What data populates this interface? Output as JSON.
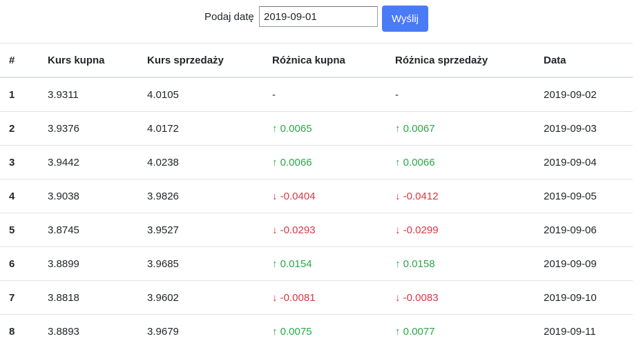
{
  "form": {
    "label": "Podaj datę",
    "date_value": "2019-09-01",
    "submit_label": "Wyślij"
  },
  "colors": {
    "accent": "#4a7bf7",
    "up": "#28a745",
    "down": "#dc3545"
  },
  "table": {
    "headers": [
      "#",
      "Kurs kupna",
      "Kurs sprzedaży",
      "Różnica kupna",
      "Różnica sprzedaży",
      "Data"
    ],
    "rows": [
      {
        "idx": "1",
        "buy": "3.9311",
        "sell": "4.0105",
        "buy_diff": "-",
        "buy_dir": "none",
        "sell_diff": "-",
        "sell_dir": "none",
        "date": "2019-09-02"
      },
      {
        "idx": "2",
        "buy": "3.9376",
        "sell": "4.0172",
        "buy_diff": "↑ 0.0065",
        "buy_dir": "up",
        "sell_diff": "↑ 0.0067",
        "sell_dir": "up",
        "date": "2019-09-03"
      },
      {
        "idx": "3",
        "buy": "3.9442",
        "sell": "4.0238",
        "buy_diff": "↑ 0.0066",
        "buy_dir": "up",
        "sell_diff": "↑ 0.0066",
        "sell_dir": "up",
        "date": "2019-09-04"
      },
      {
        "idx": "4",
        "buy": "3.9038",
        "sell": "3.9826",
        "buy_diff": "↓ -0.0404",
        "buy_dir": "down",
        "sell_diff": "↓ -0.0412",
        "sell_dir": "down",
        "date": "2019-09-05"
      },
      {
        "idx": "5",
        "buy": "3.8745",
        "sell": "3.9527",
        "buy_diff": "↓ -0.0293",
        "buy_dir": "down",
        "sell_diff": "↓ -0.0299",
        "sell_dir": "down",
        "date": "2019-09-06"
      },
      {
        "idx": "6",
        "buy": "3.8899",
        "sell": "3.9685",
        "buy_diff": "↑ 0.0154",
        "buy_dir": "up",
        "sell_diff": "↑ 0.0158",
        "sell_dir": "up",
        "date": "2019-09-09"
      },
      {
        "idx": "7",
        "buy": "3.8818",
        "sell": "3.9602",
        "buy_diff": "↓ -0.0081",
        "buy_dir": "down",
        "sell_diff": "↓ -0.0083",
        "sell_dir": "down",
        "date": "2019-09-10"
      },
      {
        "idx": "8",
        "buy": "3.8893",
        "sell": "3.9679",
        "buy_diff": "↑ 0.0075",
        "buy_dir": "up",
        "sell_diff": "↑ 0.0077",
        "sell_dir": "up",
        "date": "2019-09-11"
      }
    ]
  }
}
